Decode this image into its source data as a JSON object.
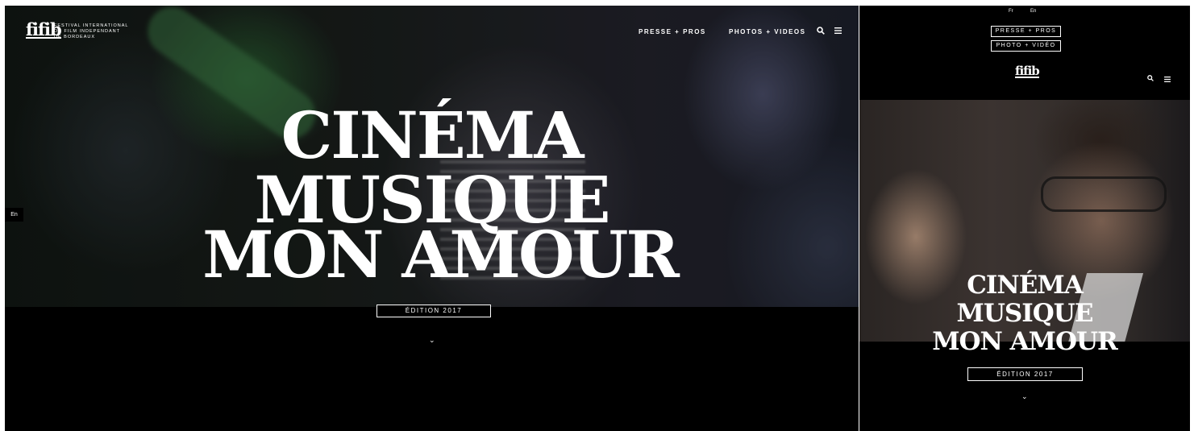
{
  "desktop": {
    "logo": {
      "mark": "fifib",
      "lines": [
        "FESTIVAL INTERNATIONAL",
        "DU FILM INDEPENDANT",
        "DE BORDEAUX"
      ]
    },
    "nav": {
      "press": "PRESSE + PROS",
      "photos": "PHOTOS + VIDEOS"
    },
    "icons": {
      "search": "search-icon",
      "menu": "menu-icon",
      "chevron": "chevron-down-icon"
    },
    "language_tab": "En",
    "hero": {
      "line1": "CINÉMA",
      "line2": "MUSIQUE",
      "line3": "MON AMOUR"
    },
    "edition": "ÉDITION 2017",
    "scroll_glyph": "⌄"
  },
  "mobile": {
    "languages": {
      "fr": "Fr",
      "en": "En"
    },
    "buttons": {
      "press": "PRESSE + PROS",
      "photo": "PHOTO + VIDÉO"
    },
    "logo_mark": "fifib",
    "hero": {
      "line1": "CINÉMA",
      "line2": "MUSIQUE",
      "line3": "MON AMOUR"
    },
    "edition": "ÉDITION 2017",
    "scroll_glyph": "⌄"
  },
  "colors": {
    "background": "#000000",
    "text": "#ffffff"
  }
}
